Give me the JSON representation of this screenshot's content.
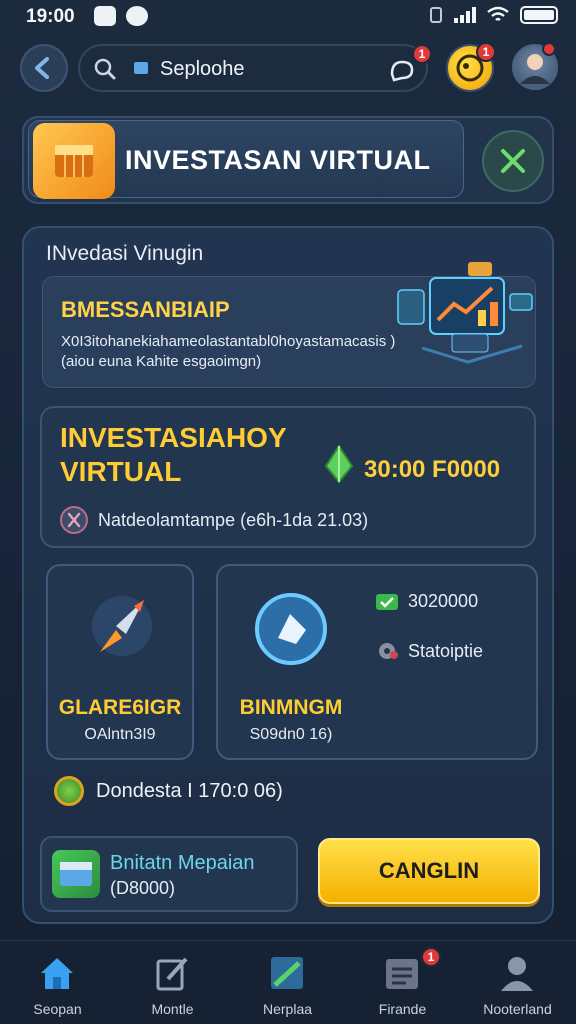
{
  "status_bar": {
    "time": "19:00"
  },
  "search": {
    "text": "Seploohe",
    "chat_badge": "1"
  },
  "coin_badge": "1",
  "banner": {
    "title": "INVESTASAN VIRTUAL"
  },
  "panel": {
    "title": "INvedasi Vinugin",
    "desc": {
      "heading": "BMESSANBIAIP",
      "line1": "X0I3itohanekiahameolastantabl0hoyastamacasis )",
      "line2": "(aiou euna Kahite esgaoimgn)"
    },
    "invest": {
      "title_line1": "INVESTASIAHOY",
      "title_line2": "VIRTUAL",
      "amount": "30:00 F0000",
      "meta": "Natdeolamtampe (e6h-1da 21.03)"
    },
    "tile1": {
      "label": "GLARE6IGR",
      "sub": "OAlntn3I9"
    },
    "tile2": {
      "label": "BINMNGM",
      "sub": "S09dn0 16)",
      "stat1": "3020000",
      "stat2": "Statoiptie"
    },
    "reward": "Dondesta I 170:0 06)",
    "wallet": {
      "title": "Bnitatn Mepaian",
      "value": "(D8000)"
    },
    "cta": "CANGLIN"
  },
  "nav": [
    {
      "label": "Seopan",
      "active": true
    },
    {
      "label": "Montle"
    },
    {
      "label": "Nerplaa"
    },
    {
      "label": "Firande",
      "badge": "1"
    },
    {
      "label": "Nooterland"
    }
  ],
  "colors": {
    "accent": "#ffcc33",
    "panel": "#223550",
    "active_nav": "#3aa0f0"
  }
}
